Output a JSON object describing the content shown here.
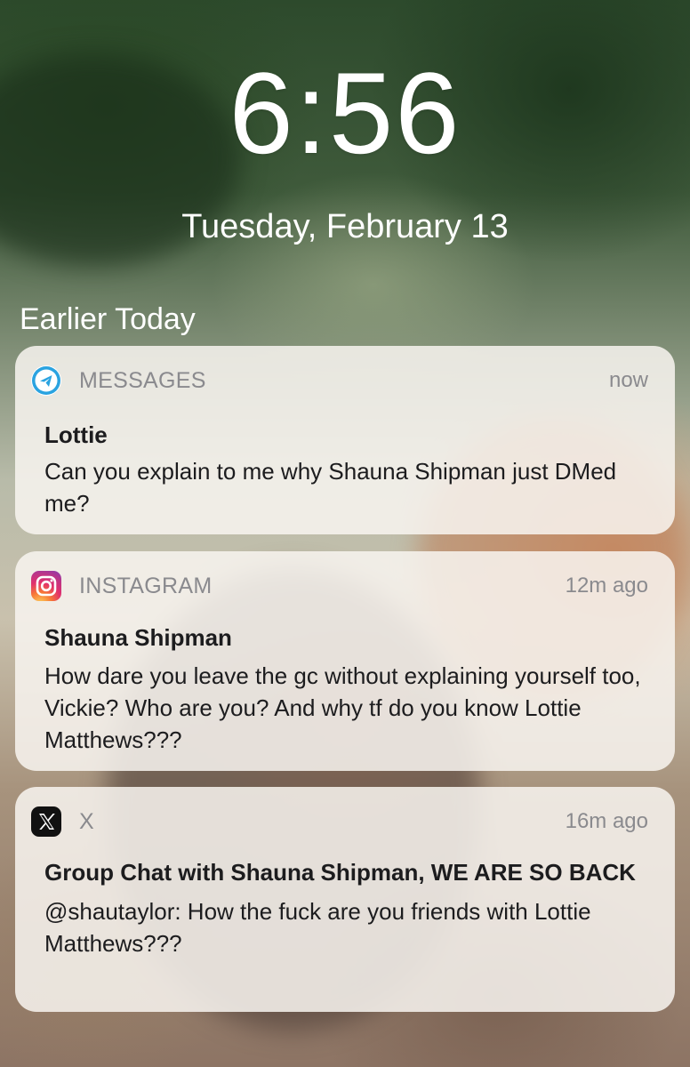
{
  "lockscreen": {
    "time": "6:56",
    "date": "Tuesday, February 13",
    "section_title": "Earlier Today"
  },
  "notifications": [
    {
      "app": "MESSAGES",
      "icon": "telegram-icon",
      "when": "now",
      "title": "Lottie",
      "message": "Can you explain to me why Shauna Shipman just DMed me?"
    },
    {
      "app": "INSTAGRAM",
      "icon": "instagram-icon",
      "when": "12m ago",
      "title": "Shauna Shipman",
      "message": "How dare you leave the gc without explaining yourself too, Vickie? Who are you? And why tf do you know Lottie Matthews???"
    },
    {
      "app": "X",
      "icon": "x-icon",
      "when": "16m ago",
      "title": "Group Chat with Shauna Shipman, WE ARE SO BACK",
      "message": "@shautaylor: How the fuck are you friends with Lottie Matthews???"
    }
  ],
  "colors": {
    "telegram_blue": "#2aa3e0",
    "card_bg": "#f8f5f0",
    "secondary_text": "#8a8a8e"
  }
}
